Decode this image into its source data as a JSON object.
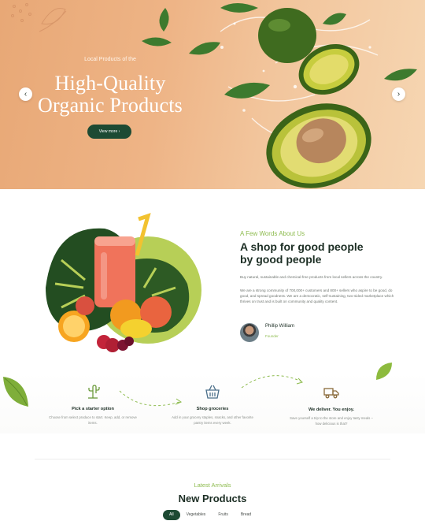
{
  "hero": {
    "kicker": "Local Products of the",
    "title_line1": "High-Quality",
    "title_line2": "Organic Products",
    "cta_label": "View more ›",
    "prev_arrow": "‹",
    "next_arrow": "›"
  },
  "about": {
    "kicker": "A Few Words About Us",
    "title_line1": "A shop for good people",
    "title_line2": "by good people",
    "paragraph1": "Buy natural, sustainable and chemical-free products from local sellers across the country.",
    "paragraph2": "We are a strong community of 700,000+ customers and 800+ sellers who aspire to be good, do good, and spread goodness. We are a democratic, self-sustaining, two-sided marketplace which thrives on trust and is built on community and quality content.",
    "author_name": "Phillip William",
    "author_role": "Founder"
  },
  "steps": [
    {
      "icon": "cactus-icon",
      "title": "Pick a starter option",
      "text": "Choose from select produce to start. Keep, add, or remove items."
    },
    {
      "icon": "basket-icon",
      "title": "Shop groceries",
      "text": "Add in your grocery staples, snacks, and other favorite pantry items every week."
    },
    {
      "icon": "truck-icon",
      "title": "We deliver. You enjoy.",
      "text": "Save yourself a trip to the store and enjoy tasty meals – how delicious is that?"
    }
  ],
  "new_products": {
    "kicker": "Latest Arrivals",
    "title": "New Products",
    "filters": [
      "All",
      "Vegetables",
      "Fruits",
      "Bread"
    ],
    "active_filter": "All"
  },
  "colors": {
    "brand_dark": "#1d4a33",
    "accent_green": "#8dbb4e",
    "hero_peach": "#eeb486"
  }
}
